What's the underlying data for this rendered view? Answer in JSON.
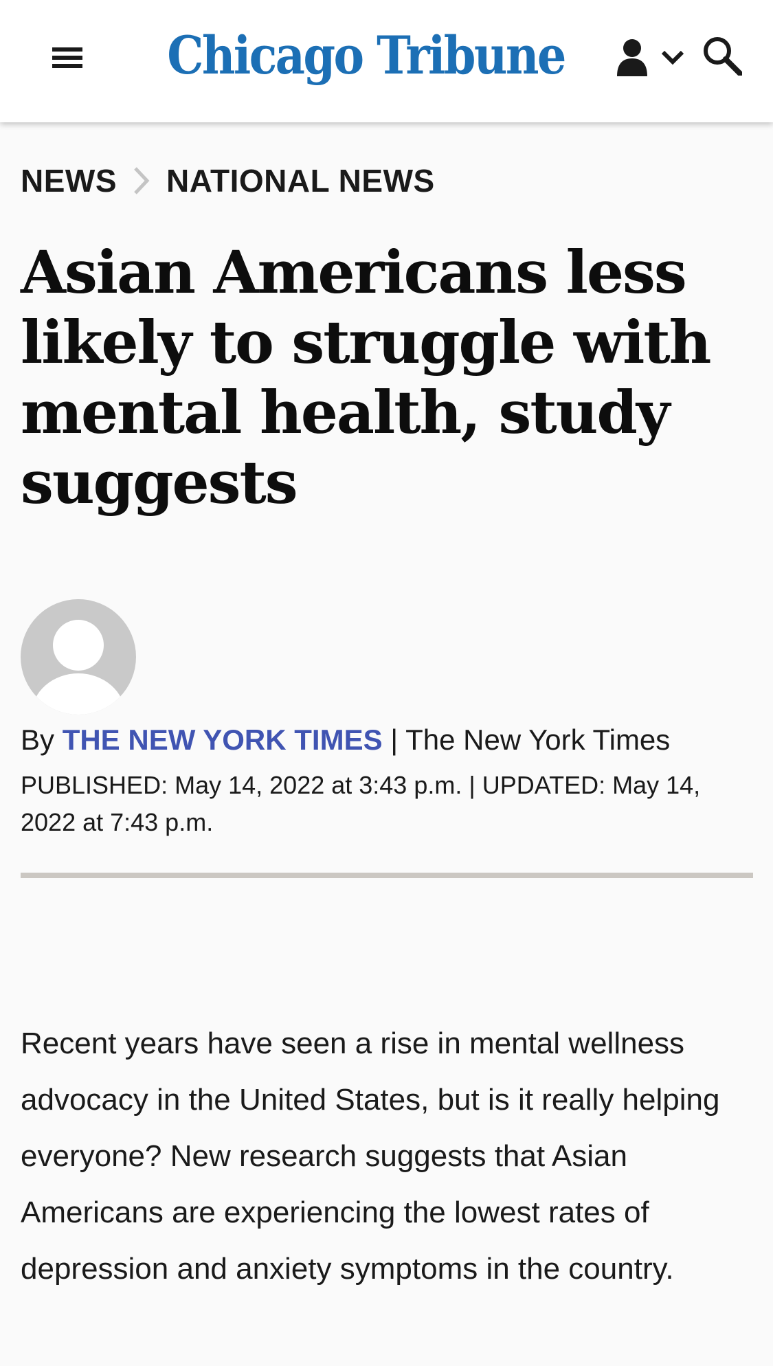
{
  "header": {
    "logo_text": "Chicago Tribune",
    "brand_color": "#1c6fb5",
    "menu_icon": "hamburger-icon",
    "account_icon": "user-icon",
    "account_chevron_icon": "chevron-down-icon",
    "search_icon": "search-icon"
  },
  "breadcrumb": {
    "items": [
      {
        "label": "NEWS"
      },
      {
        "label": "NATIONAL NEWS"
      }
    ],
    "separator_icon": "chevron-right-icon"
  },
  "article": {
    "headline": "Asian Americans less likely to struggle with mental health, study suggests",
    "byline_prefix": "By",
    "author": "THE NEW YORK TIMES",
    "byline_separator": "|",
    "source": "The New York Times",
    "published_label": "PUBLISHED:",
    "published_value": "May 14, 2022 at 3:43 p.m.",
    "date_separator": "|",
    "updated_label": "UPDATED:",
    "updated_value": "May 14, 2022 at 7:43 p.m.",
    "author_link_color": "#4054b2",
    "body_paragraph": "Recent years have seen a rise in mental wellness advocacy in the United States, but is it really helping everyone? New research suggests that Asian Americans are experiencing the lowest rates of depression and anxiety symptoms in the country."
  }
}
